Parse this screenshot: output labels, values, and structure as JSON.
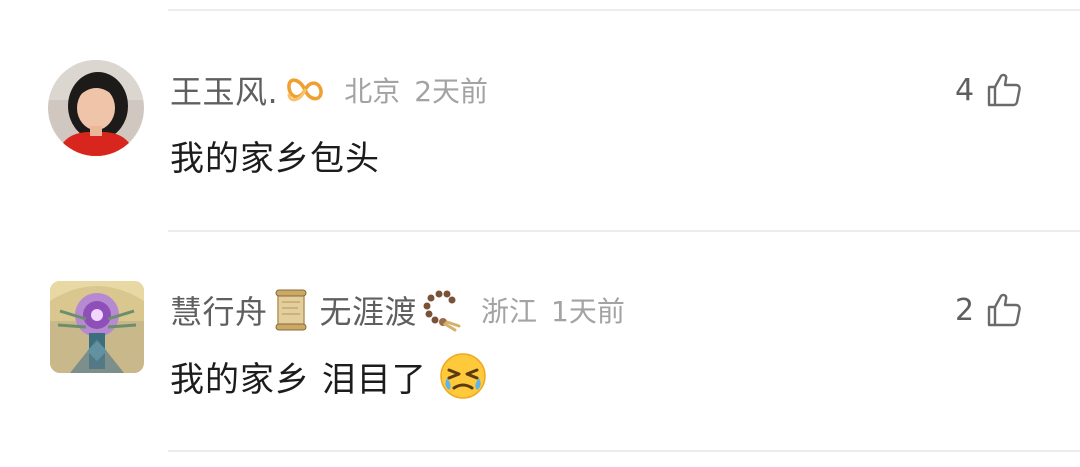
{
  "comments": [
    {
      "username": "王玉风.",
      "badge_icon": "orange-infinity-badge-icon",
      "location": "北京",
      "time": "2天前",
      "text": "我的家乡包头",
      "likes": "4"
    },
    {
      "username": "慧行舟",
      "badge_icon": "scroll-icon",
      "username_suffix": "无涯渡",
      "suffix_icon": "prayer-beads-icon",
      "location": "浙江",
      "time": "1天前",
      "text": "我的家乡 泪目了",
      "text_emoji": "crying-face-emoji-icon",
      "likes": "2"
    }
  ],
  "colors": {
    "username": "#5f5f5f",
    "meta": "#a3a3a3",
    "text": "#1c1c1c",
    "divider": "#ececec",
    "badge": "#f0a030"
  }
}
